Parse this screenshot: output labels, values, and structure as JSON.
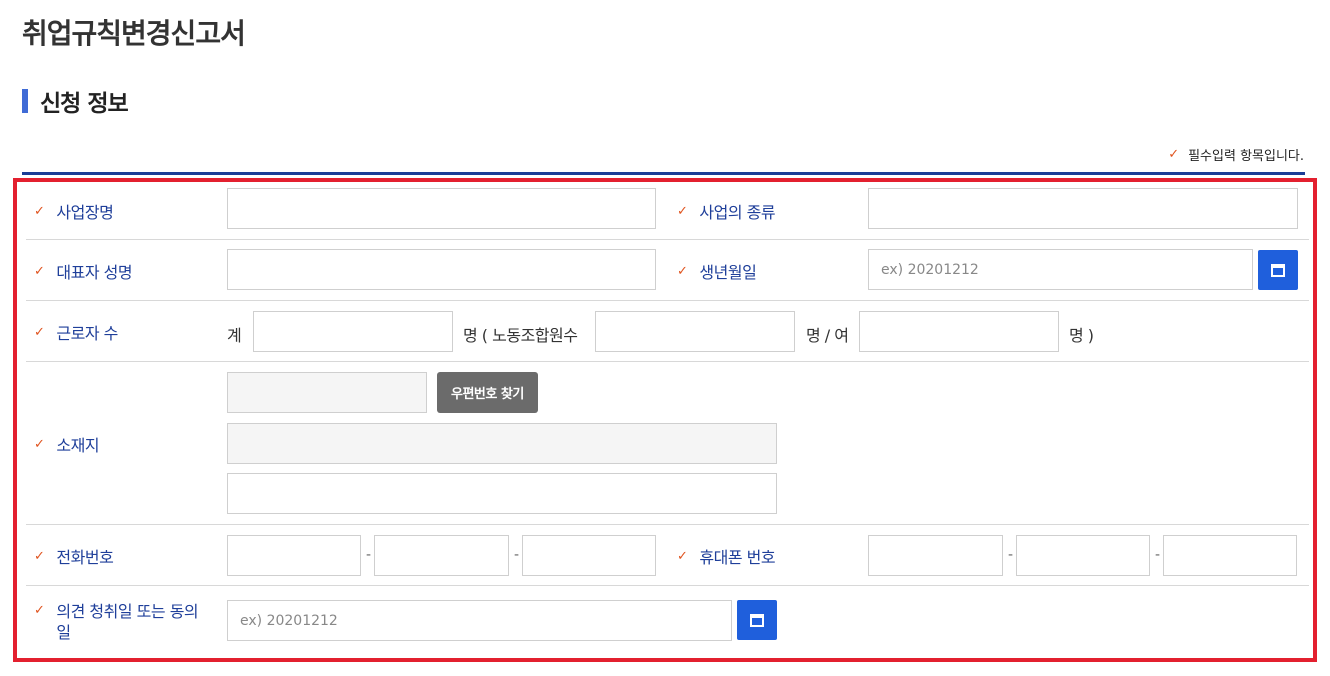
{
  "page": {
    "title": "취업규칙변경신고서"
  },
  "section": {
    "title": "신청 정보"
  },
  "required_note": "필수입력 항목입니다.",
  "colors": {
    "accent_blue": "#1f5fdc",
    "label_blue": "#1f3f9a",
    "required_mark": "#e0541f",
    "highlight_border": "#e3202f"
  },
  "form": {
    "business_name": {
      "label": "사업장명",
      "value": ""
    },
    "business_type": {
      "label": "사업의 종류",
      "value": ""
    },
    "representative_name": {
      "label": "대표자 성명",
      "value": ""
    },
    "birth_date": {
      "label": "생년월일",
      "placeholder": "ex) 20201212",
      "button_icon": "calendar-icon"
    },
    "workers": {
      "label": "근로자 수",
      "total_prefix": "계",
      "union_text": "명 ( 노동조합원수",
      "female_text": "명 / 여",
      "close_text": "명 )"
    },
    "address": {
      "label": "소재지",
      "zip_button": "우편번호 찾기"
    },
    "phone": {
      "label": "전화번호",
      "separator": "-"
    },
    "mobile": {
      "label": "휴대폰 번호",
      "separator": "-"
    },
    "opinion_date": {
      "label": "의견 청취일 또는 동의일",
      "placeholder": "ex) 20201212",
      "button_icon": "calendar-icon"
    }
  }
}
